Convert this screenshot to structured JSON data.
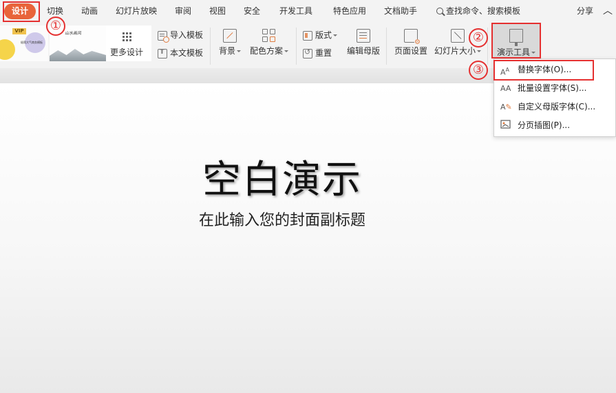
{
  "menubar": {
    "tabs": [
      {
        "label": "设计"
      },
      {
        "label": "切换"
      },
      {
        "label": "动画"
      },
      {
        "label": "幻灯片放映"
      },
      {
        "label": "审阅"
      },
      {
        "label": "视图"
      },
      {
        "label": "安全"
      },
      {
        "label": "开发工具"
      },
      {
        "label": "特色应用"
      },
      {
        "label": "文档助手"
      }
    ],
    "search_label": "查找命令、搜索模板",
    "share_label": "分享"
  },
  "ribbon": {
    "template1_badge": "VIP",
    "template1_caption": "极简大气商务模板",
    "template2_caption": "山水画风",
    "more_design": "更多设计",
    "import_template": "导入模板",
    "this_template": "本文模板",
    "background": "背景",
    "color_scheme": "配色方案",
    "layout": "版式",
    "reset": "重置",
    "edit_master": "编辑母版",
    "page_setup": "页面设置",
    "slide_size": "幻灯片大小",
    "presentation_tools": "演示工具"
  },
  "dropdown": {
    "items": [
      {
        "label": "替换字体(O)...",
        "icon": "AA"
      },
      {
        "label": "批量设置字体(S)...",
        "icon": "AA"
      },
      {
        "label": "自定义母版字体(C)...",
        "icon": "A"
      },
      {
        "label": "分页插图(P)...",
        "icon": "img"
      }
    ]
  },
  "slide": {
    "title": "空白演示",
    "subtitle": "在此输入您的封面副标题"
  },
  "annotations": {
    "step1": "①",
    "step2": "②",
    "step3": "③"
  },
  "colors": {
    "accent": "#e8643a",
    "highlight": "#e53030",
    "ribbon_bg": "#f3f3f3"
  }
}
